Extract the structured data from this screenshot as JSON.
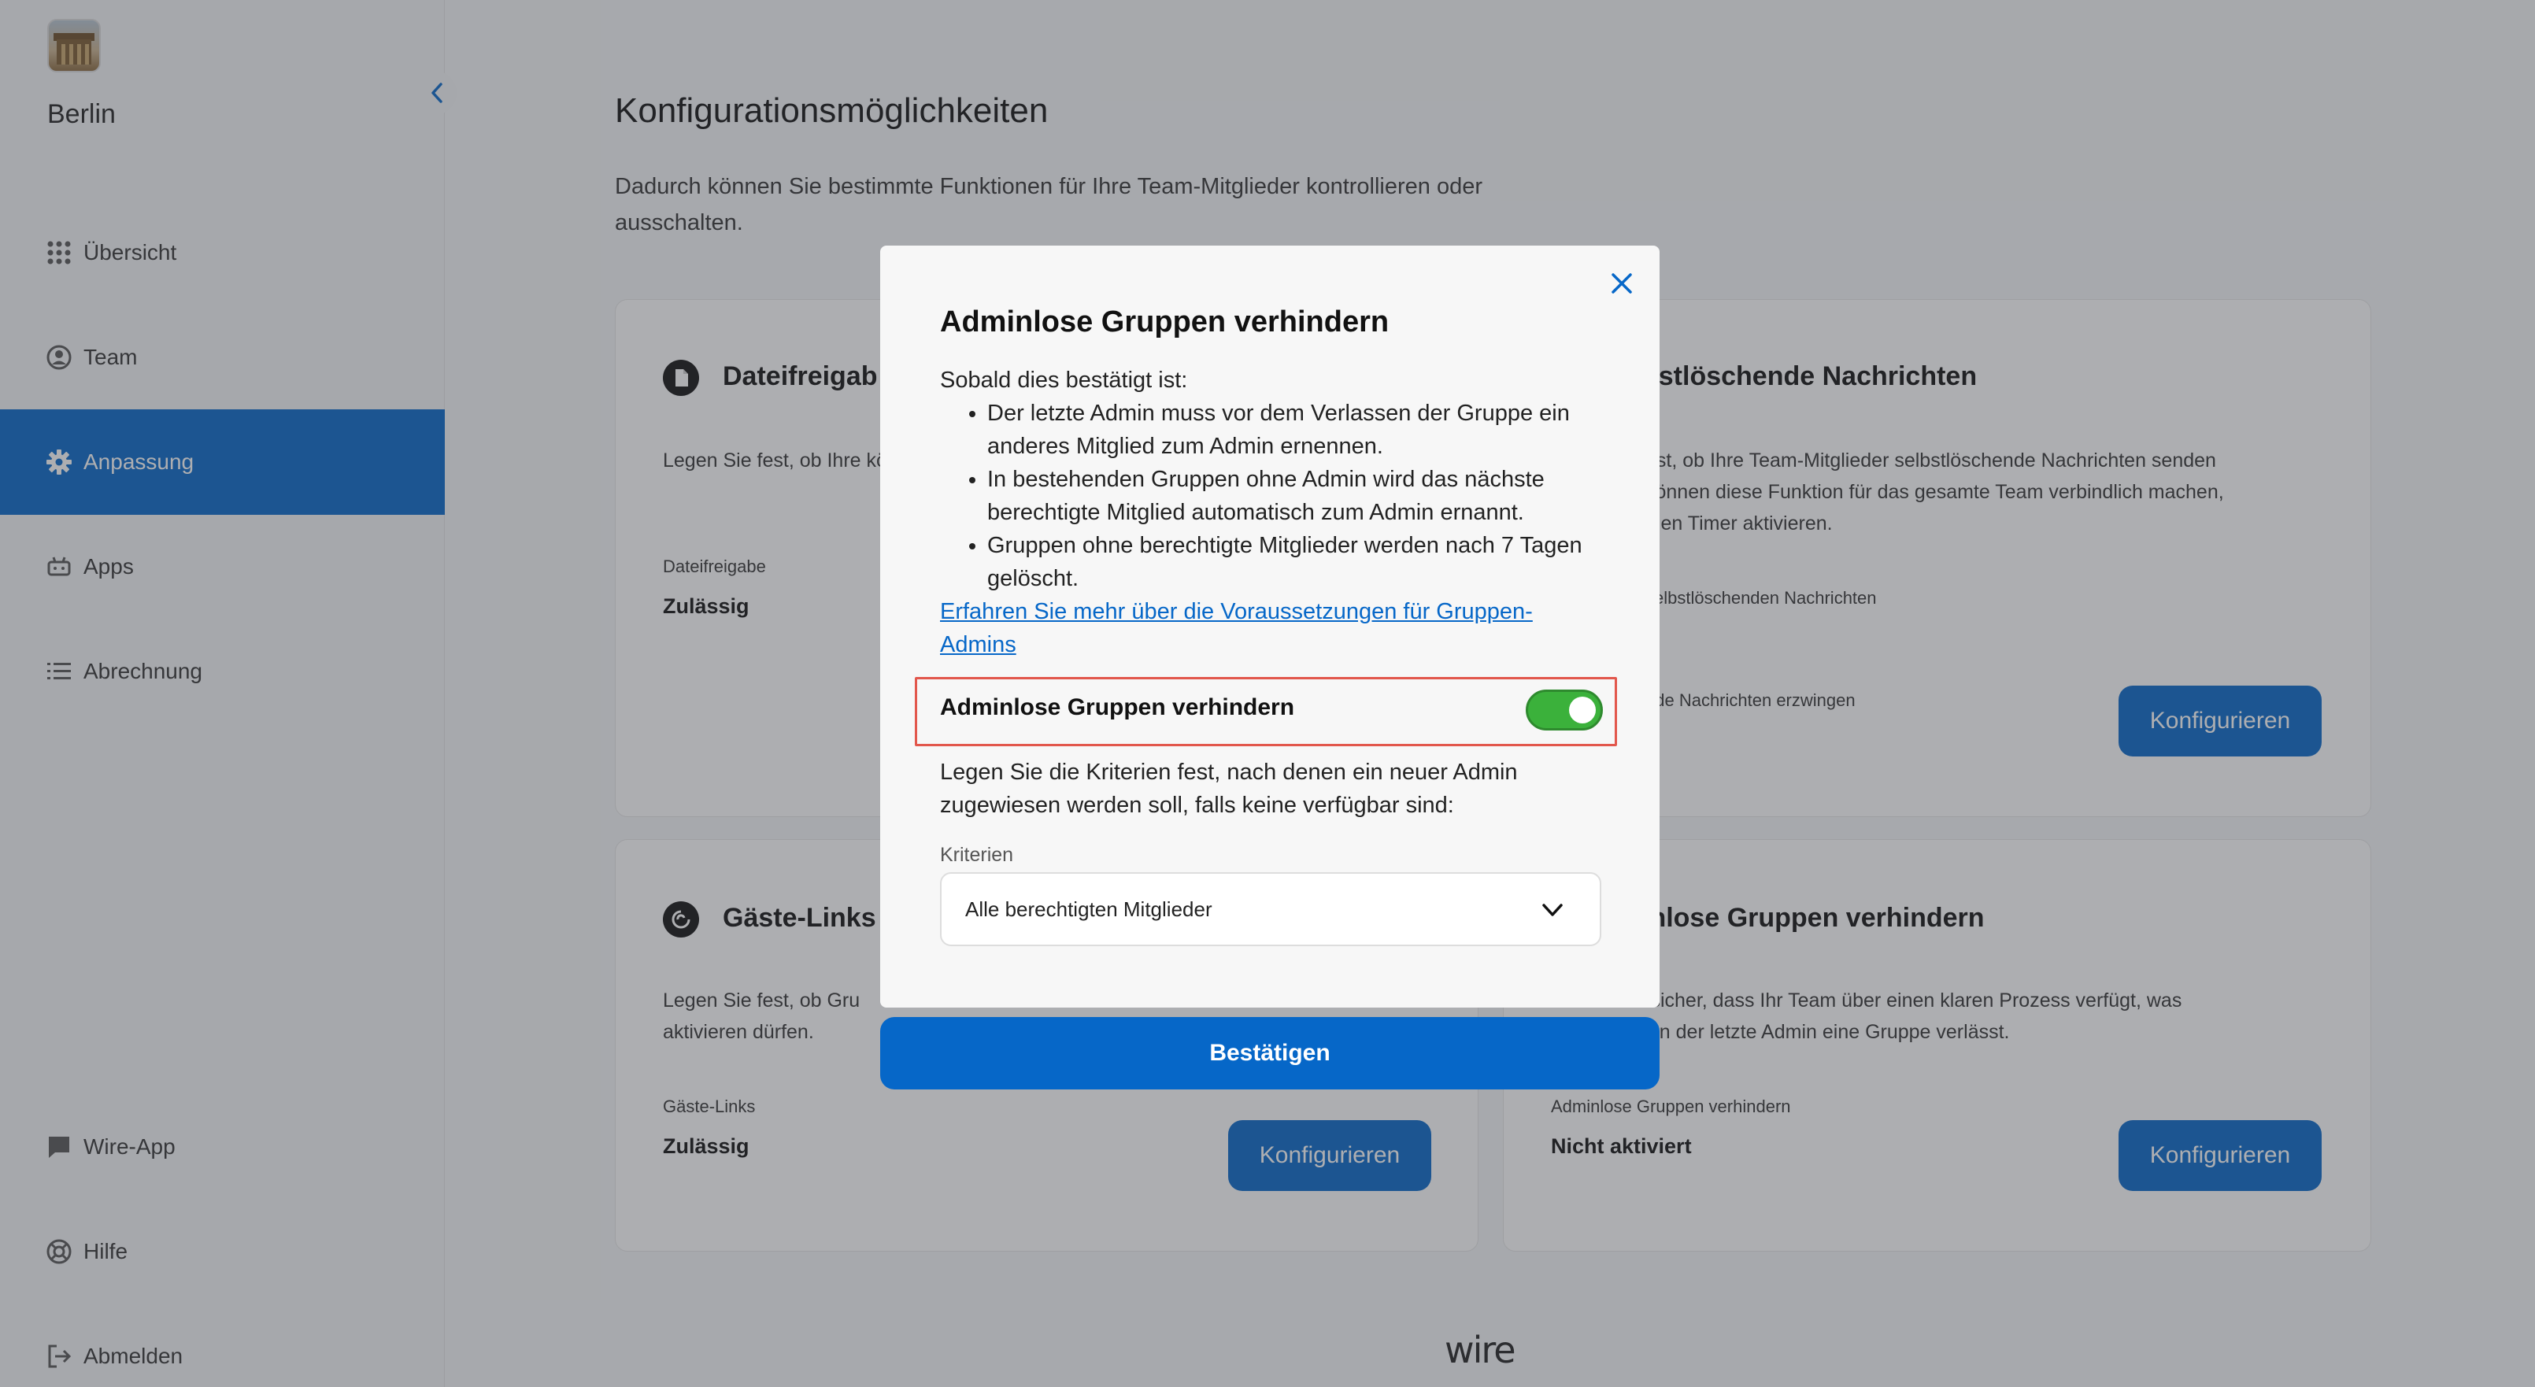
{
  "sidebar": {
    "team_name": "Berlin",
    "items": [
      {
        "label": "Übersicht",
        "icon": "grid-icon"
      },
      {
        "label": "Team",
        "icon": "user-circle-icon"
      },
      {
        "label": "Anpassung",
        "icon": "gear-icon",
        "active": true
      },
      {
        "label": "Apps",
        "icon": "robot-icon"
      },
      {
        "label": "Abrechnung",
        "icon": "list-icon"
      }
    ],
    "bottom_items": [
      {
        "label": "Wire-App",
        "icon": "chat-bubble-icon"
      },
      {
        "label": "Hilfe",
        "icon": "lifebuoy-icon"
      },
      {
        "label": "Abmelden",
        "icon": "logout-icon"
      }
    ]
  },
  "main": {
    "title": "Konfigurationsmöglichkeiten",
    "description": "Dadurch können Sie bestimmte Funktionen für Ihre Team-Mitglieder kontrollieren oder ausschalten.",
    "cards": [
      {
        "title": "Dateifreigab",
        "icon": "file-icon",
        "description": "Legen Sie fest, ob Ihre können.",
        "label": "Dateifreigabe",
        "status": "Zulässig"
      },
      {
        "title": "bstlöschende Nachrichten",
        "description_lines": [
          "est, ob Ihre Team-Mitglieder selbstlöschende Nachrichten senden",
          " können diese Funktion für das gesamte Team verbindlich machen,",
          "inen Timer aktivieren."
        ],
        "label": "selbstlöschenden Nachrichten",
        "label2": "nde Nachrichten erzwingen",
        "button": "Konfigurieren"
      },
      {
        "title": "Gäste-Links",
        "icon": "link-icon",
        "description_lines": [
          "Legen Sie fest, ob Gru",
          "aktivieren dürfen."
        ],
        "label": "Gäste-Links",
        "status": "Zulässig",
        "button": "Konfigurieren"
      },
      {
        "title": "inlose Gruppen verhindern",
        "description_lines": [
          "Stellen Sie sicher, dass Ihr Team über einen klaren Prozess verfügt, was",
          "enn der letzte Admin eine Gruppe verlässt."
        ],
        "label": "Adminlose Gruppen verhindern",
        "status": "Nicht aktiviert",
        "button": "Konfigurieren"
      }
    ],
    "footer_logo": "wire"
  },
  "modal": {
    "title": "Adminlose Gruppen verhindern",
    "intro": "Sobald dies bestätigt ist:",
    "bullets": [
      "Der letzte Admin muss vor dem Verlassen der Gruppe ein anderes Mitglied zum Admin ernennen.",
      "In bestehenden Gruppen ohne Admin wird das nächste berechtigte Mitglied automatisch zum Admin ernannt.",
      "Gruppen ohne berechtigte Mitglieder werden nach 7 Tagen gelöscht."
    ],
    "link": "Erfahren Sie mehr über die Voraussetzungen für Gruppen-Admins",
    "toggle_label": "Adminlose Gruppen verhindern",
    "toggle_on": true,
    "criteria_text": "Legen Sie die Kriterien fest, nach denen ein neuer Admin zugewiesen werden soll, falls keine verfügbar sind:",
    "criteria_label": "Kriterien",
    "criteria_value": "Alle berechtigten Mitglieder",
    "confirm": "Bestätigen"
  },
  "colors": {
    "accent": "#0667c8",
    "toggle_on": "#3bb13b",
    "highlight": "#e2574c"
  }
}
